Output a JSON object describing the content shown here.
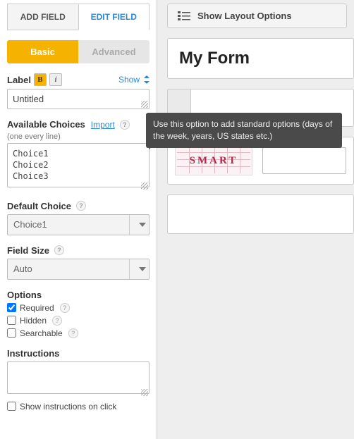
{
  "tabs": {
    "add": "ADD FIELD",
    "edit": "EDIT FIELD"
  },
  "subtabs": {
    "basic": "Basic",
    "advanced": "Advanced"
  },
  "label_section": {
    "title": "Label",
    "show": "Show",
    "value": "Untitled"
  },
  "choices": {
    "title": "Available Choices",
    "import": "Import",
    "hint": "(one every line)",
    "value": "Choice1\nChoice2\nChoice3"
  },
  "default_choice": {
    "title": "Default Choice",
    "value": "Choice1"
  },
  "field_size": {
    "title": "Field Size",
    "value": "Auto"
  },
  "options": {
    "title": "Options",
    "required": "Required",
    "hidden": "Hidden",
    "searchable": "Searchable"
  },
  "instructions": {
    "title": "Instructions",
    "value": "",
    "show_on_click": "Show instructions on click"
  },
  "main": {
    "layout_button": "Show Layout Options",
    "form_title": "My Form",
    "captcha": "SMART"
  },
  "tooltip": "Use this option to add standard options (days of the week, years, US states etc.)"
}
